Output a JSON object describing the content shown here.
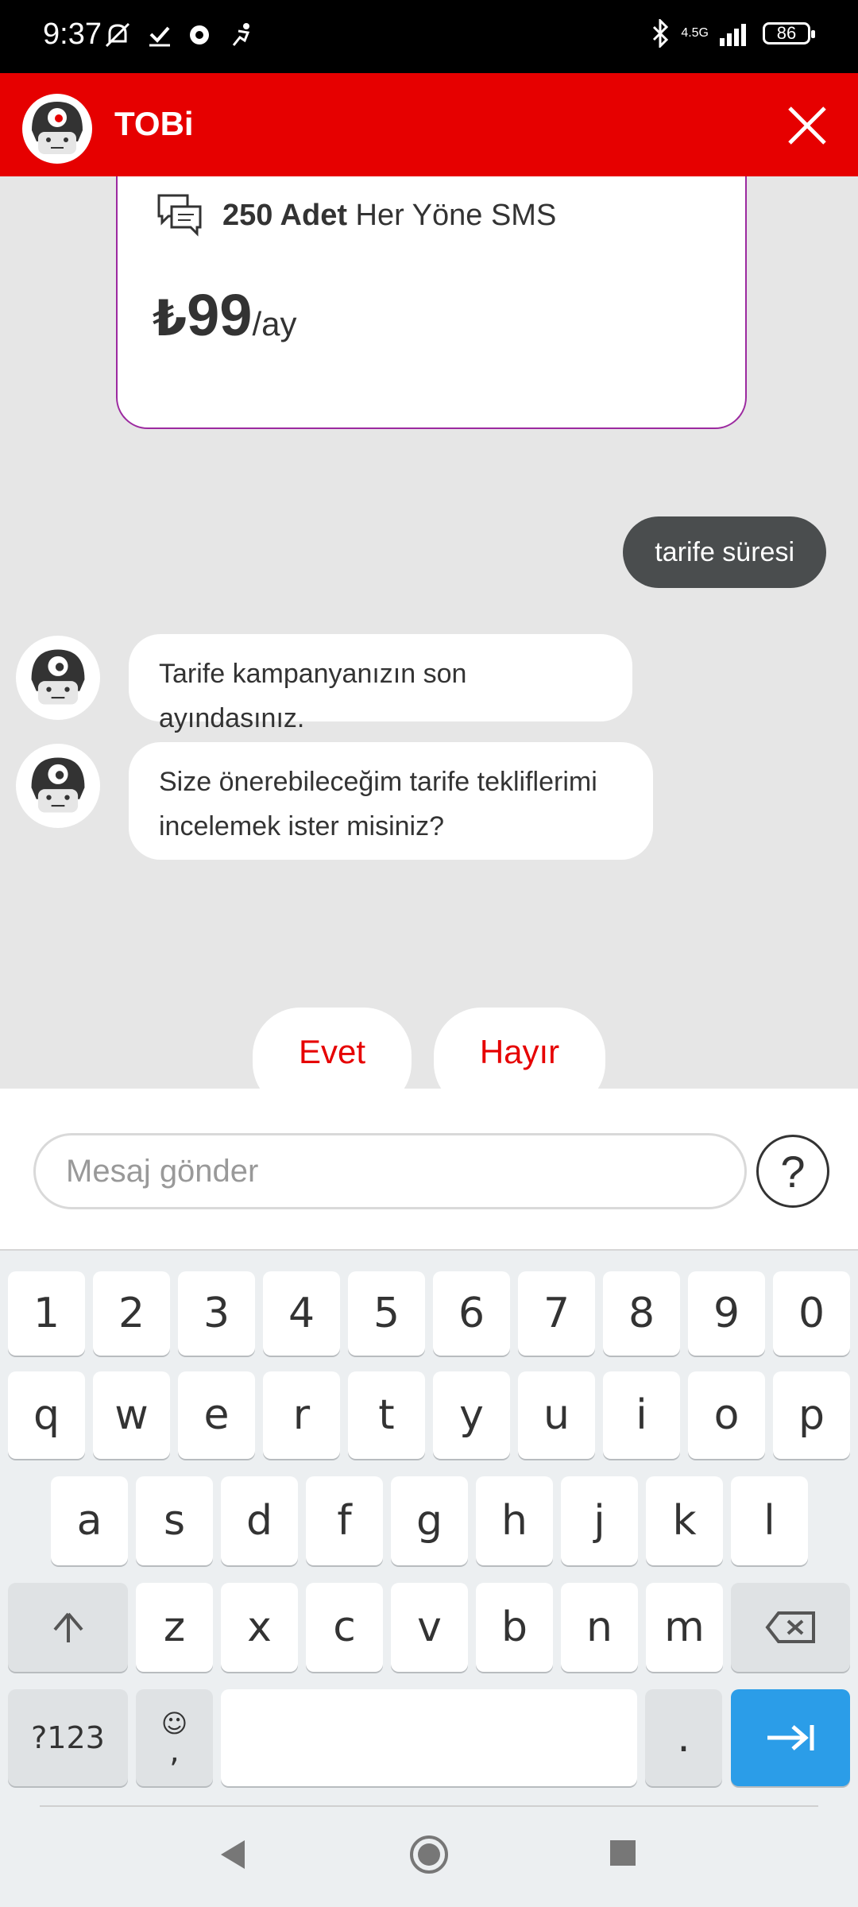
{
  "status_bar": {
    "time": "9:37",
    "network": "4.5G",
    "battery": "86"
  },
  "header": {
    "title": "TOBi"
  },
  "card": {
    "sms_count": "250 Adet",
    "sms_label": " Her Yöne SMS",
    "currency": "₺",
    "price": "99",
    "period": "/ay"
  },
  "messages": {
    "user": "tarife süresi",
    "bot1": "Tarife kampanyanızın son ayındasınız.",
    "bot2_line1": "Size önerebileceğim tarife tekliflerimi",
    "bot2_line2": "incelemek ister misiniz?"
  },
  "quick_replies": {
    "yes": "Evet",
    "no": "Hayır"
  },
  "composer": {
    "placeholder": "Mesaj gönder",
    "help": "?"
  },
  "keyboard": {
    "row_numbers": [
      "1",
      "2",
      "3",
      "4",
      "5",
      "6",
      "7",
      "8",
      "9",
      "0"
    ],
    "row1": [
      "q",
      "w",
      "e",
      "r",
      "t",
      "y",
      "u",
      "i",
      "o",
      "p"
    ],
    "row2": [
      "a",
      "s",
      "d",
      "f",
      "g",
      "h",
      "j",
      "k",
      "l"
    ],
    "row3": [
      "z",
      "x",
      "c",
      "v",
      "b",
      "n",
      "m"
    ],
    "symbols_label": "?123",
    "comma": ",",
    "period": "."
  },
  "colors": {
    "brand_red": "#e60000",
    "card_border": "#9c2aa0",
    "user_bubble": "#4a4d4e",
    "enter_key": "#2b9de8"
  }
}
